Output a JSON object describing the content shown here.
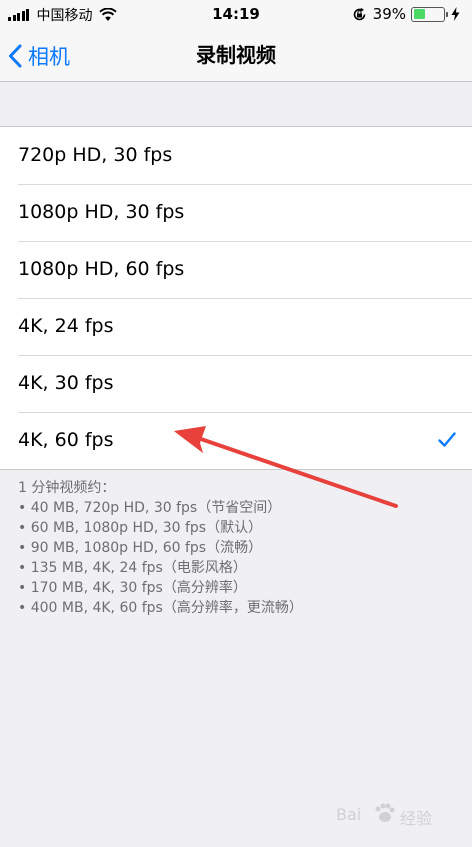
{
  "status_bar": {
    "carrier": "中国移动",
    "time": "14:19",
    "battery_percent": "39%",
    "battery_level": 0.39
  },
  "nav": {
    "back_label": "相机",
    "title": "录制视频"
  },
  "options": [
    {
      "label": "720p HD, 30 fps",
      "selected": false
    },
    {
      "label": "1080p HD, 30 fps",
      "selected": false
    },
    {
      "label": "1080p HD, 60 fps",
      "selected": false
    },
    {
      "label": "4K, 24 fps",
      "selected": false
    },
    {
      "label": "4K, 30 fps",
      "selected": false
    },
    {
      "label": "4K, 60 fps",
      "selected": true
    }
  ],
  "footer": {
    "heading": "1 分钟视频约：",
    "lines": [
      "• 40 MB, 720p HD, 30 fps（节省空间）",
      "• 60 MB, 1080p HD, 30 fps（默认）",
      "• 90 MB, 1080p HD, 60 fps（流畅）",
      "• 135 MB, 4K, 24 fps（电影风格）",
      "• 170 MB, 4K, 30 fps（高分辨率）",
      "• 400 MB, 4K, 60 fps（高分辨率，更流畅）"
    ]
  },
  "colors": {
    "accent": "#0a7aff",
    "annotation_arrow": "#e8403a",
    "battery_fill": "#4cd964"
  },
  "watermark": {
    "brand": "Bai",
    "brand_cn": "经验"
  }
}
